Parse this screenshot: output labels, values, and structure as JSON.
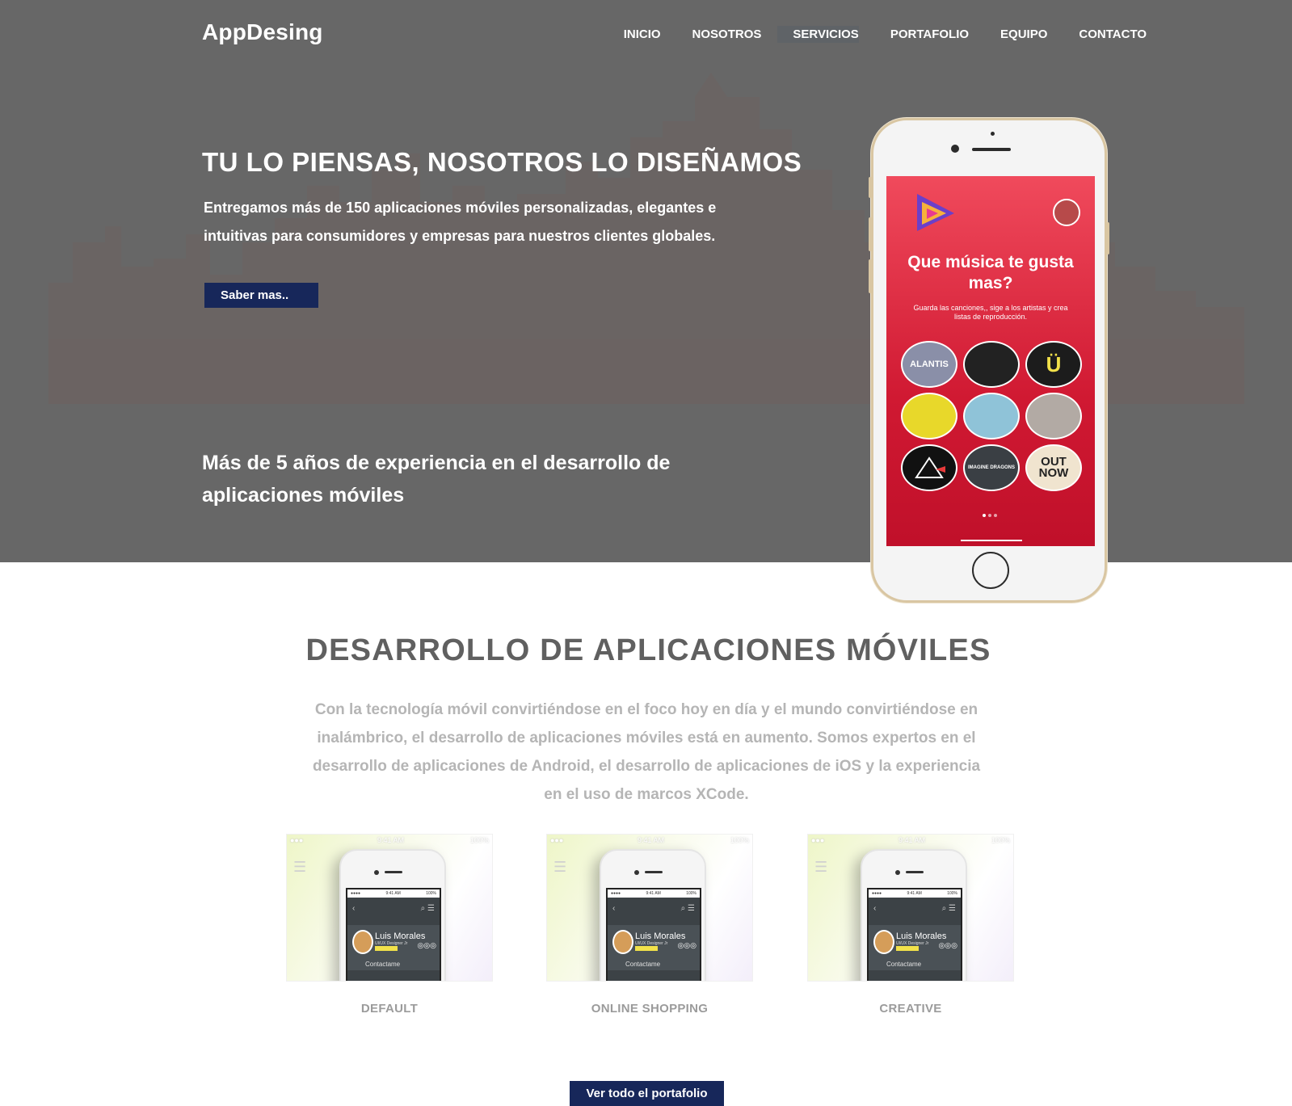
{
  "nav": {
    "brand": "AppDesing",
    "items": [
      "INICIO",
      "NOSOTROS",
      "SERVICIOS",
      "PORTAFOLIO",
      "EQUIPO",
      "CONTACTO"
    ],
    "active": "SERVICIOS"
  },
  "hero": {
    "title": "TU LO PIENSAS, NOSOTROS LO DISEÑAMOS",
    "text": "Entregamos más de 150 aplicaciones móviles personalizadas, elegantes e intuitivas para consumidores y empresas para nuestros clientes globales.",
    "button": "Saber mas..",
    "subtitle": "Más de 5 años de experiencia en el desarrollo de aplicaciones móviles"
  },
  "phone": {
    "heading": "Que música te gusta mas?",
    "subtext": "Guarda las canciones,, sige a los artistas y crea listas de reproducción.",
    "artists": [
      "ALANTIS",
      "",
      "Ü",
      "",
      "",
      "",
      "",
      "IMAGINE DRAGONS",
      "OUT NOW"
    ]
  },
  "section": {
    "title": "DESARROLLO DE APLICACIONES MÓVILES",
    "text": "Con la tecnología móvil convirtiéndose en el foco hoy en día y el mundo convirtiéndose en inalámbrico, el desarrollo de aplicaciones móviles está en aumento. Somos expertos en el desarrollo de aplicaciones de Android, el desarrollo de aplicaciones de iOS y la experiencia en el uso de marcos XCode."
  },
  "cards": [
    {
      "label": "DEFAULT",
      "time": "9:41 AM",
      "battery": "100%",
      "name": "Luis Morales",
      "role": "UI/UX Designer Jr",
      "contact": "Contactame"
    },
    {
      "label": "ONLINE SHOPPING",
      "time": "9:41 AM",
      "battery": "100%",
      "name": "Luis Morales",
      "role": "UI/UX Designer Jr",
      "contact": "Contactame"
    },
    {
      "label": "CREATIVE",
      "time": "9:41 AM",
      "battery": "100%",
      "name": "Luis Morales",
      "role": "UI/UX Designer Jr",
      "contact": "Contactame"
    }
  ],
  "portfolio_button": "Ver todo el portafolio",
  "colors": {
    "hero_bg": "#676767",
    "button_bg": "#17275a",
    "title_gray": "#606060",
    "text_gray": "#b5b5b5",
    "screen_red": "#d01932"
  }
}
